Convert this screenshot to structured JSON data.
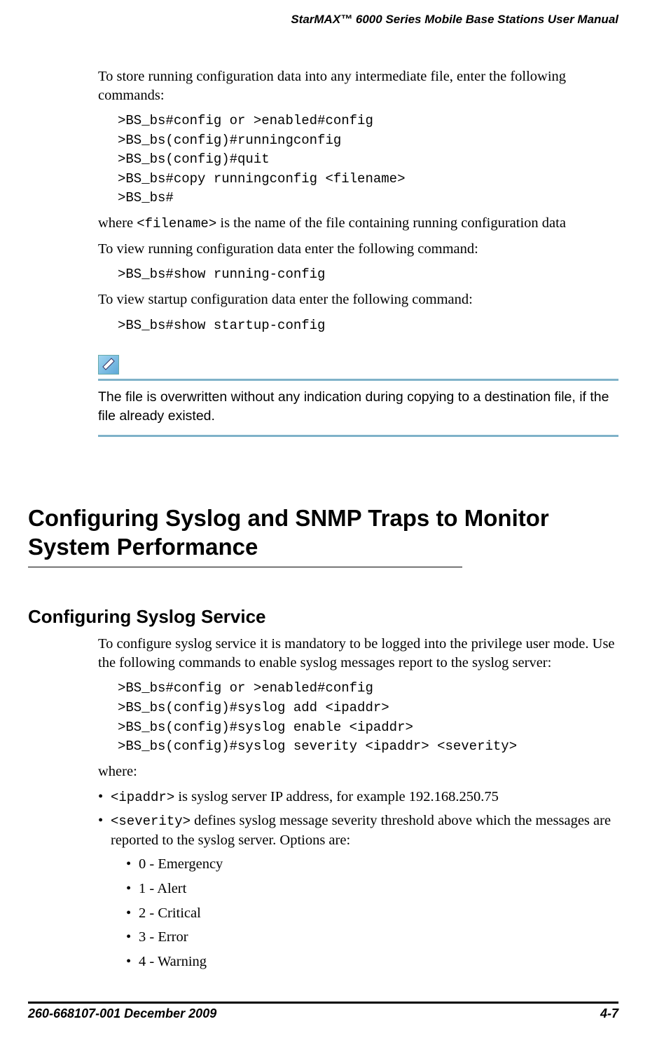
{
  "header": {
    "title": "StarMAX™ 6000 Series Mobile Base Stations User Manual"
  },
  "section1": {
    "intro": "To store running configuration data into any intermediate file, enter the following commands:",
    "cmds1": [
      ">BS_bs#config or >enabled#config",
      ">BS_bs(config)#runningconfig",
      ">BS_bs(config)#quit",
      ">BS_bs#copy runningconfig <filename>",
      ">BS_bs#"
    ],
    "where_pre": "where ",
    "where_mono": "<filename>",
    "where_post": " is the name of the file containing running configuration data",
    "view_run_intro": "To view running configuration data enter the following command:",
    "view_run_cmd": ">BS_bs#show running-config",
    "view_start_intro": "To view startup configuration data enter the following command:",
    "view_start_cmd": ">BS_bs#show startup-config",
    "note": "The file is overwritten without any indication during copying to a destination file, if the file already existed."
  },
  "section2": {
    "h1": "Configuring Syslog and SNMP Traps to Monitor System Performance",
    "h2": "Configuring Syslog Service",
    "intro": "To configure syslog service it is mandatory to be logged into the privilege user mode. Use the following commands to enable syslog messages report to the syslog server:",
    "cmds": [
      ">BS_bs#config or >enabled#config",
      ">BS_bs(config)#syslog add <ipaddr>",
      ">BS_bs(config)#syslog enable <ipaddr>",
      ">BS_bs(config)#syslog severity <ipaddr> <severity>"
    ],
    "where": "where:",
    "b1_mono": "<ipaddr>",
    "b1_post": " is syslog server IP address, for example 192.168.250.75",
    "b2_mono": "<severity>",
    "b2_post": " defines syslog message severity threshold above which the messages are reported to the syslog server. Options are:",
    "severities": [
      "0 - Emergency",
      "1 - Alert",
      "2 - Critical",
      "3 - Error",
      "4 - Warning"
    ]
  },
  "footer": {
    "left": "260-668107-001 December 2009",
    "right": "4-7"
  }
}
